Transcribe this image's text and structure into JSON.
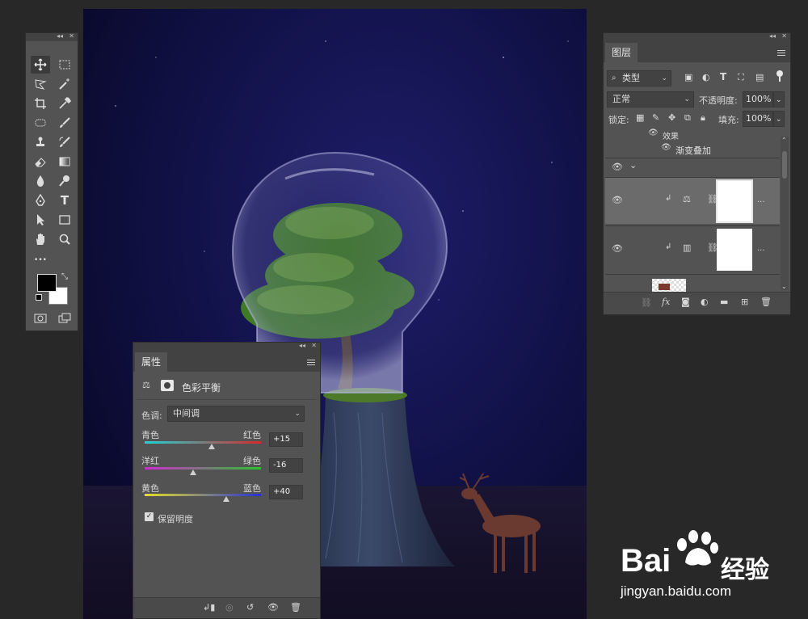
{
  "toolbar": {
    "tools": [
      "move-tool",
      "marquee-tool",
      "lasso-tool",
      "magic-wand-tool",
      "crop-tool",
      "eyedropper-tool",
      "spot-healing-tool",
      "brush-tool",
      "clone-stamp-tool",
      "history-brush-tool",
      "eraser-tool",
      "gradient-tool",
      "blur-tool",
      "dodge-tool",
      "pen-tool",
      "type-tool",
      "path-selection-tool",
      "rectangle-tool",
      "hand-tool",
      "zoom-tool",
      "more-tools",
      "",
      "quick-mask",
      "screen-mode"
    ],
    "type_glyph": "T",
    "more_glyph": "•••",
    "foreground_color": "#000000",
    "background_color": "#ffffff"
  },
  "layers": {
    "tab_label": "图层",
    "filter_value": "类型",
    "blend_mode": "正常",
    "opacity_label": "不透明度:",
    "opacity_value": "100%",
    "lock_label": "锁定:",
    "fill_label": "填充:",
    "fill_value": "100%",
    "effects_label": "效果",
    "gradient_overlay_label": "渐变叠加",
    "ellipsis": "...",
    "type_icon": "T"
  },
  "properties": {
    "tab_label": "属性",
    "adjustment_title": "色彩平衡",
    "tone_label": "色调:",
    "tone_value": "中间调",
    "sliders": [
      {
        "left": "青色",
        "right": "红色",
        "value": "+15",
        "level": 15
      },
      {
        "left": "洋红",
        "right": "绿色",
        "value": "-16",
        "level": -16
      },
      {
        "left": "黄色",
        "right": "蓝色",
        "value": "+40",
        "level": 40
      }
    ],
    "preserve_luminosity_label": "保留明度",
    "preserve_luminosity_checked": true
  },
  "watermark": {
    "brand": "Bai",
    "brand_suffix": "经验",
    "url": "jingyan.baidu.com"
  }
}
